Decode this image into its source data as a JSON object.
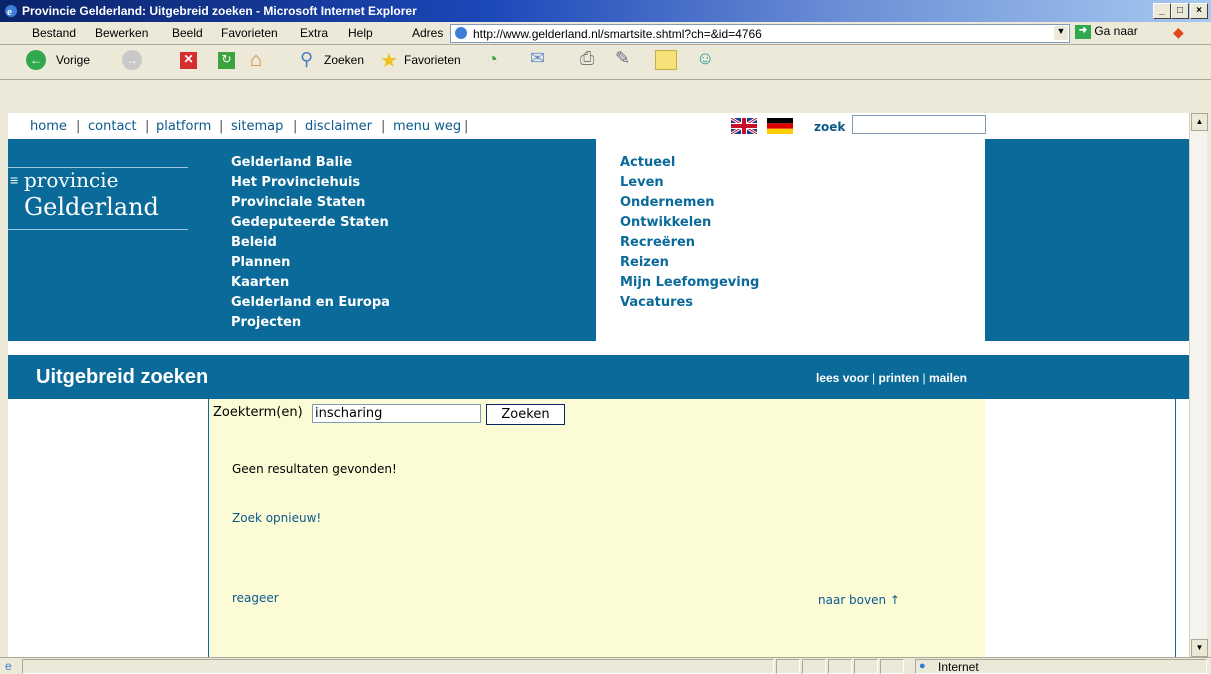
{
  "window": {
    "title": "Provincie Gelderland: Uitgebreid zoeken - Microsoft Internet Explorer",
    "min": "_",
    "max": "□",
    "close": "×"
  },
  "menubar": {
    "items": [
      "Bestand",
      "Bewerken",
      "Beeld",
      "Favorieten",
      "Extra",
      "Help"
    ],
    "address_label": "Adres",
    "url": "http://www.gelderland.nl/smartsite.shtml?ch=&id=4766",
    "go_label": "Ga naar"
  },
  "toolbar": {
    "back": "Vorige",
    "search": "Zoeken",
    "favorites": "Favorieten"
  },
  "topnav": {
    "links": [
      "home",
      "contact",
      "platform",
      "sitemap",
      "disclaimer",
      "menu weg"
    ],
    "search_label": "zoek",
    "search_value": ""
  },
  "logo": {
    "line1": "provincie",
    "line2": "Gelderland"
  },
  "nav_primary": [
    "Gelderland Balie",
    "Het Provinciehuis",
    "Provinciale Staten",
    "Gedeputeerde Staten",
    "Beleid",
    "Plannen",
    "Kaarten",
    "Gelderland en Europa",
    "Projecten"
  ],
  "nav_secondary": [
    "Actueel",
    "Leven",
    "Ondernemen",
    "Ontwikkelen",
    "Recreëren",
    "Reizen",
    "Mijn Leefomgeving",
    "Vacatures"
  ],
  "page": {
    "title": "Uitgebreid zoeken",
    "actions": [
      "lees voor",
      "printen",
      "mailen"
    ],
    "search_label": "Zoekterm(en)",
    "search_value": "inscharing",
    "search_button": "Zoeken",
    "no_results": "Geen resultaten gevonden!",
    "retry": "Zoek opnieuw!",
    "feedback": "reageer",
    "to_top": "naar boven ↑"
  },
  "status": {
    "zone": "Internet"
  },
  "colors": {
    "brand": "#0a6a9a",
    "content_bg": "#fbfbd6"
  }
}
